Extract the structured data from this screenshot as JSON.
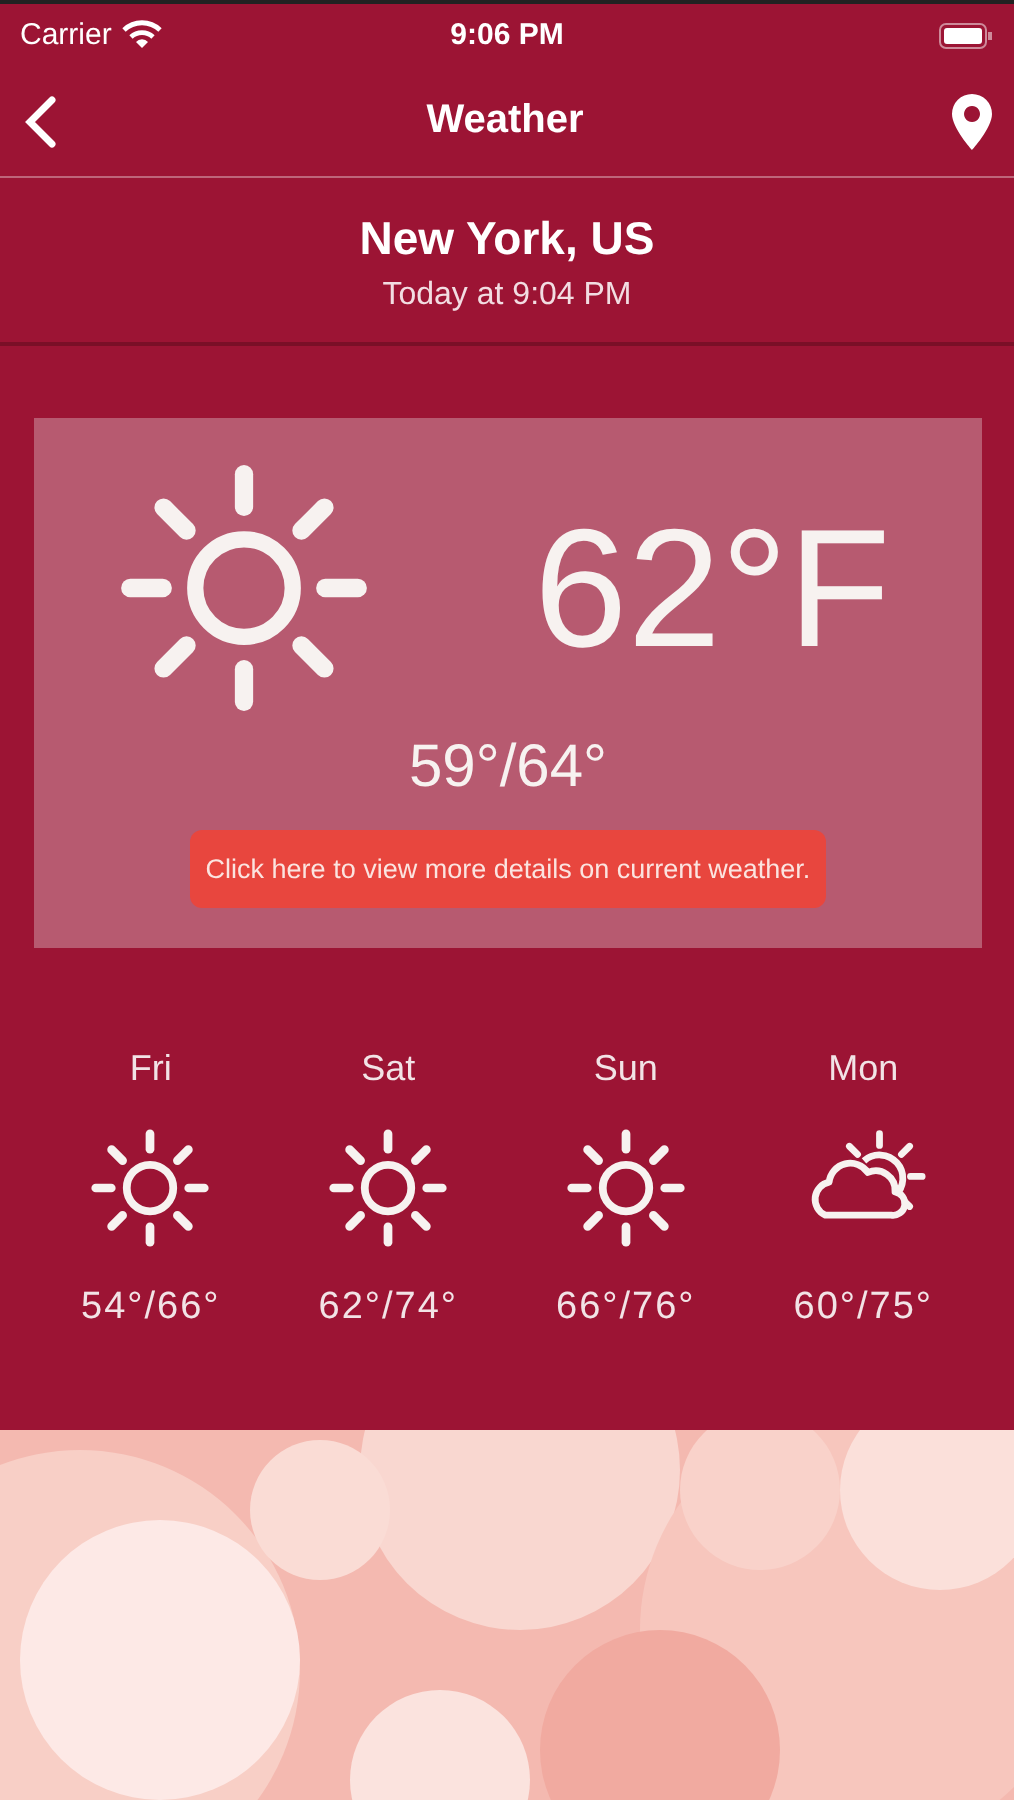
{
  "status_bar": {
    "carrier": "Carrier",
    "time": "9:06 PM"
  },
  "nav": {
    "title": "Weather"
  },
  "location": {
    "name": "New York, US",
    "updated": "Today at 9:04 PM"
  },
  "current": {
    "kind": "sunny",
    "temperature": "62°F",
    "range": "59°/64°",
    "details_button": "Click here to view more details on current weather."
  },
  "forecast": [
    {
      "day": "Fri",
      "kind": "sunny",
      "range": "54°/66°"
    },
    {
      "day": "Sat",
      "kind": "sunny",
      "range": "62°/74°"
    },
    {
      "day": "Sun",
      "kind": "sunny",
      "range": "66°/76°"
    },
    {
      "day": "Mon",
      "kind": "partly-cloudy",
      "range": "60°/75°"
    }
  ]
}
